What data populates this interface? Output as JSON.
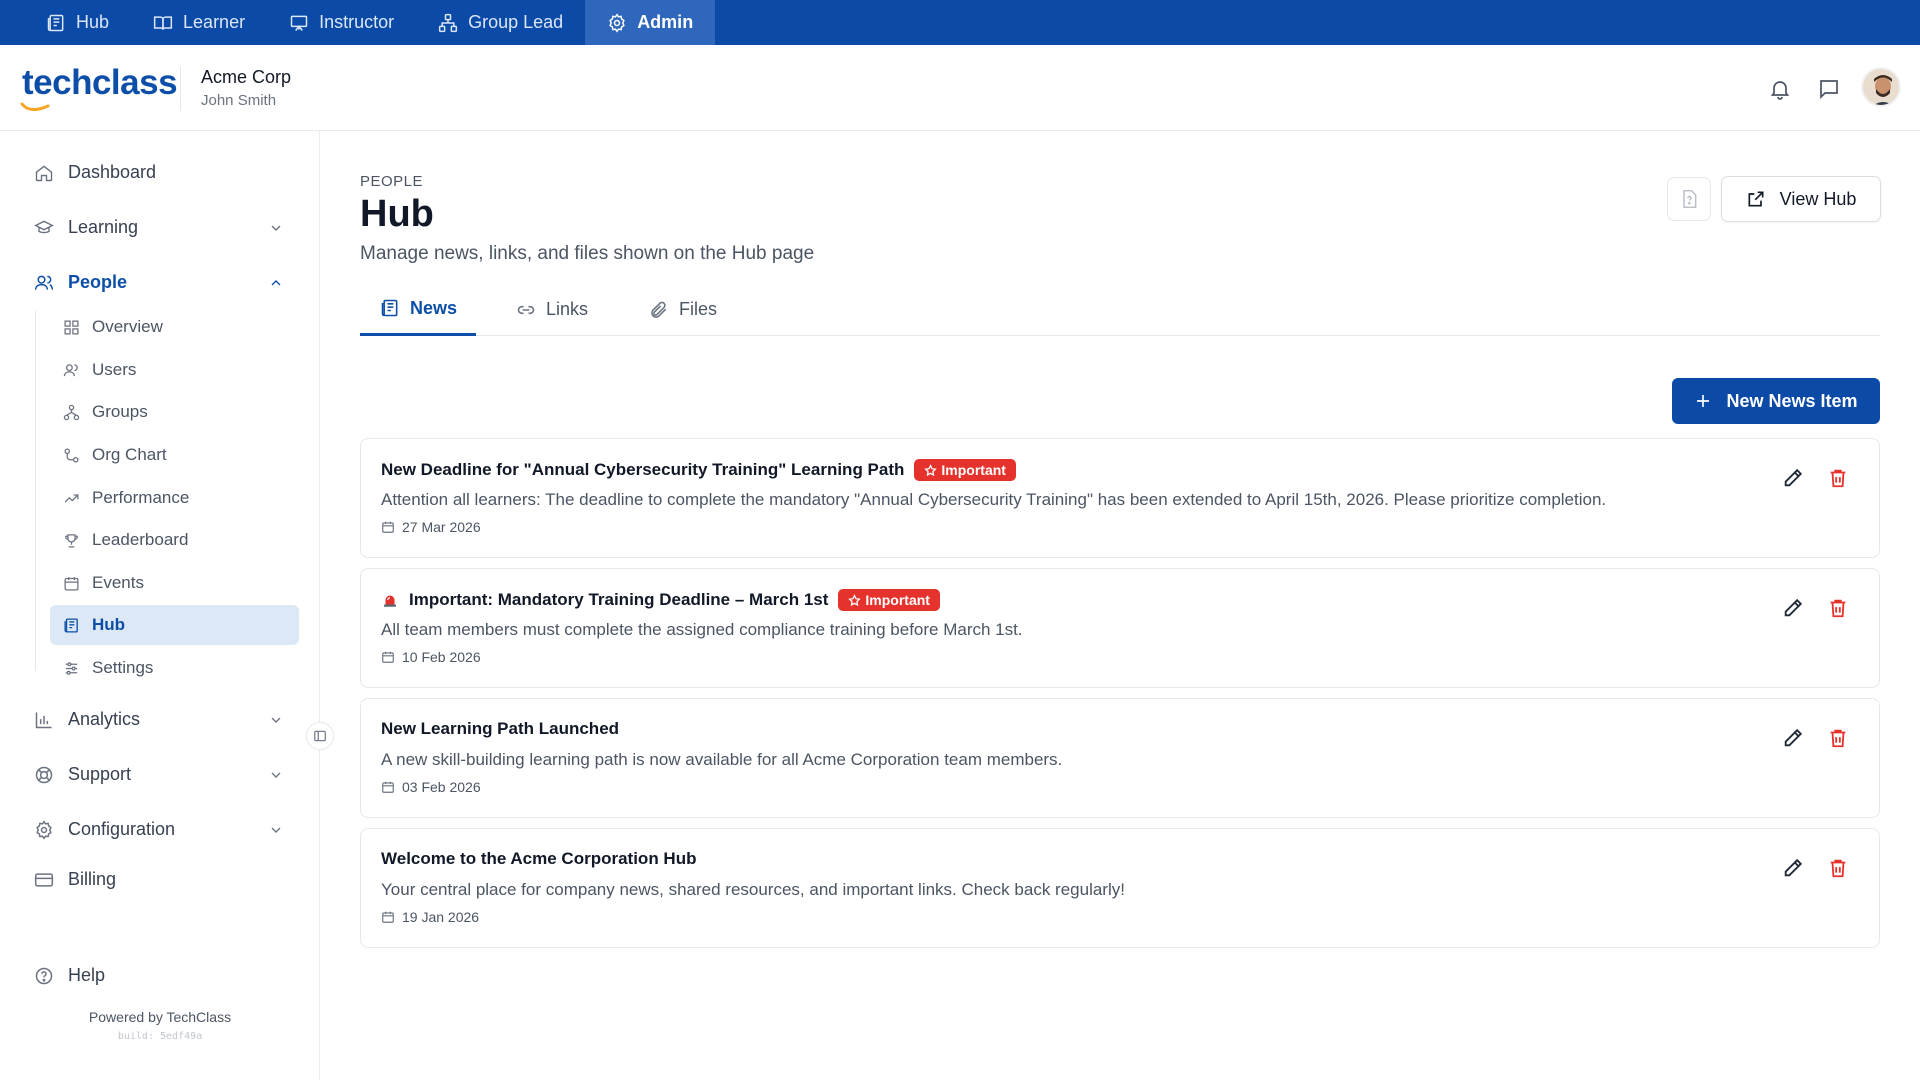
{
  "rolebar": {
    "items": [
      {
        "label": "Hub",
        "icon": "newspaper-icon"
      },
      {
        "label": "Learner",
        "icon": "book-open-icon"
      },
      {
        "label": "Instructor",
        "icon": "presentation-icon"
      },
      {
        "label": "Group Lead",
        "icon": "network-icon"
      },
      {
        "label": "Admin",
        "icon": "gear-icon",
        "active": true
      }
    ]
  },
  "header": {
    "logo_text": "techclass",
    "org_name": "Acme Corp",
    "user_name": "John Smith"
  },
  "sidebar": {
    "dashboard": "Dashboard",
    "learning": "Learning",
    "people": "People",
    "people_items": [
      "Overview",
      "Users",
      "Groups",
      "Org Chart",
      "Performance",
      "Leaderboard",
      "Events",
      "Hub",
      "Settings"
    ],
    "active_item": "Hub",
    "analytics": "Analytics",
    "support": "Support",
    "configuration": "Configuration",
    "billing": "Billing",
    "help": "Help",
    "powered_by": "Powered by TechClass",
    "build": "build: 5edf49a"
  },
  "main": {
    "breadcrumb": "PEOPLE",
    "title": "Hub",
    "subtitle": "Manage news, links, and files shown on the Hub page",
    "view_hub_label": "View Hub",
    "tabs": [
      {
        "label": "News",
        "active": true
      },
      {
        "label": "Links"
      },
      {
        "label": "Files"
      }
    ],
    "new_button_label": "New News Item",
    "news": [
      {
        "title": "New Deadline for \"Annual Cybersecurity Training\" Learning Path",
        "badge": "Important",
        "body": "Attention all learners: The deadline to complete the mandatory \"Annual Cybersecurity Training\" has been extended to April 15th, 2026. Please prioritize completion.",
        "date": "27 Mar 2026"
      },
      {
        "title": "Important: Mandatory Training Deadline – March 1st",
        "badge": "Important",
        "body": "All team members must complete the assigned compliance training before March 1st.",
        "date": "10 Feb 2026"
      },
      {
        "title": "New Learning Path Launched",
        "badge": "",
        "body": "A new skill-building learning path is now available for all Acme Corporation team members.",
        "date": "03 Feb 2026"
      },
      {
        "title": "Welcome to the Acme Corporation Hub",
        "badge": "",
        "body": "Your central place for company news, shared resources, and important links. Check back regularly!",
        "date": "19 Jan 2026"
      }
    ]
  },
  "colors": {
    "brand": "#0b4aa6",
    "danger": "#e5322d",
    "active_bg": "#dde8f7"
  }
}
